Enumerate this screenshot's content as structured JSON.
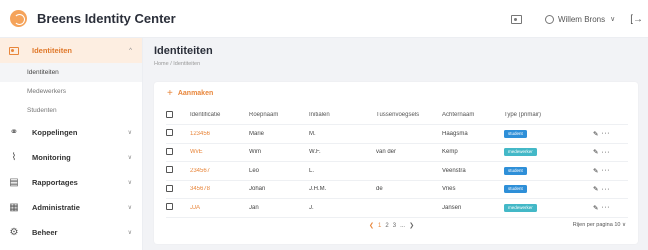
{
  "header": {
    "app_title": "Breens Identity Center",
    "user_name": "Willem Brons",
    "user_chevron": "∨",
    "logout_glyph": "[→"
  },
  "sidebar": {
    "sections": [
      {
        "label": "Identiteiten",
        "icon": "id-card-icon",
        "arrow": "^"
      },
      {
        "label": "Koppelingen",
        "icon": "link-icon",
        "glyph": "⚭",
        "arrow": "∨"
      },
      {
        "label": "Monitoring",
        "icon": "chart-icon",
        "glyph": "⌇",
        "arrow": "∨"
      },
      {
        "label": "Rapportages",
        "icon": "report-icon",
        "glyph": "▤",
        "arrow": "∨"
      },
      {
        "label": "Administratie",
        "icon": "admin-icon",
        "glyph": "▦",
        "arrow": "∨"
      },
      {
        "label": "Beheer",
        "icon": "gear-icon",
        "glyph": "⚙",
        "arrow": "∨"
      }
    ],
    "sub_items": [
      "Identiteiten",
      "Medewerkers",
      "Studenten"
    ]
  },
  "main": {
    "title": "Identiteiten",
    "breadcrumb": "Home  /  Identiteiten",
    "add_label": "Aanmaken",
    "add_glyph": "+"
  },
  "table": {
    "columns": [
      "Identificatie",
      "Roepnaam",
      "Initialen",
      "Tussenvoegsels",
      "Achternaam",
      "Type (primair)"
    ],
    "rows": [
      {
        "id": "123456",
        "roepnaam": "Marie",
        "initialen": "M.",
        "tussenvoegsels": "",
        "achternaam": "Haagsma",
        "type": "student"
      },
      {
        "id": "WvE",
        "roepnaam": "Wim",
        "initialen": "W.F.",
        "tussenvoegsels": "van der",
        "achternaam": "Kemp",
        "type": "medewerker"
      },
      {
        "id": "234567",
        "roepnaam": "Leo",
        "initialen": "L.",
        "tussenvoegsels": "",
        "achternaam": "Veenstra",
        "type": "student"
      },
      {
        "id": "345678",
        "roepnaam": "Johan",
        "initialen": "J.H.M.",
        "tussenvoegsels": "de",
        "achternaam": "Vries",
        "type": "student"
      },
      {
        "id": "JJA",
        "roepnaam": "Jan",
        "initialen": "J.",
        "tussenvoegsels": "",
        "achternaam": "Jansen",
        "type": "medewerker"
      }
    ]
  },
  "pagination": {
    "prev": "❮",
    "pages": [
      "1",
      "2",
      "3",
      "...",
      "❯"
    ],
    "current": "1",
    "per_page_label": "Rijen per pagina",
    "per_page_value": "10"
  },
  "colors": {
    "accent": "#e8863b",
    "student_badge": "#2e8fd8",
    "medewerker_badge": "#43b8c7"
  }
}
